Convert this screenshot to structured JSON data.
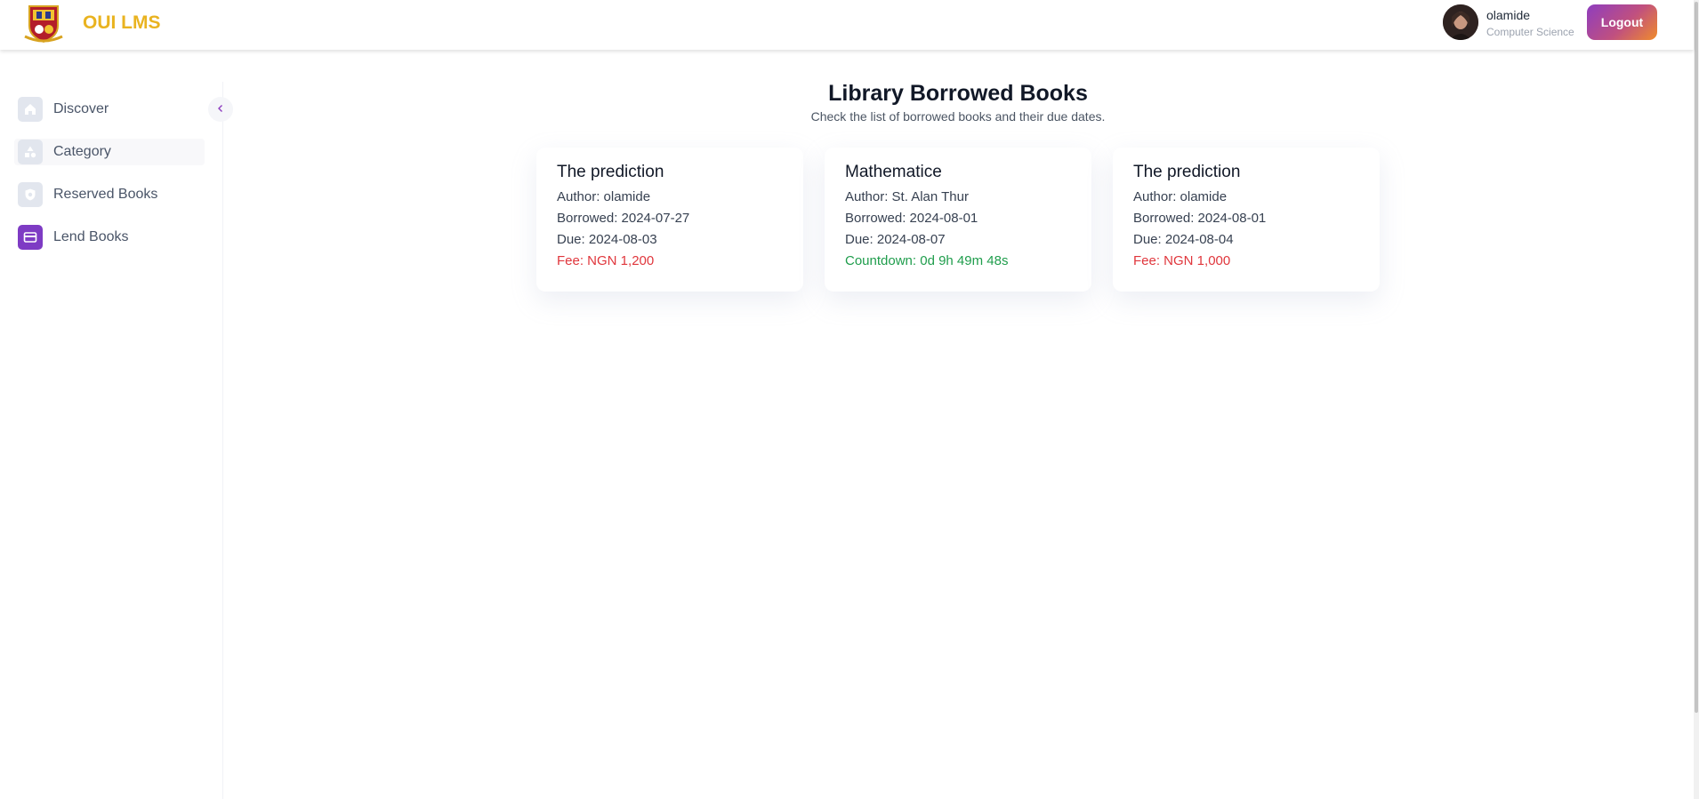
{
  "header": {
    "brand": "OUI LMS",
    "user": {
      "name": "olamide",
      "department": "Computer Science"
    },
    "logout_label": "Logout"
  },
  "sidebar": {
    "items": [
      {
        "label": "Discover",
        "icon": "home-icon"
      },
      {
        "label": "Category",
        "icon": "shapes-icon",
        "active": true
      },
      {
        "label": "Reserved Books",
        "icon": "shield-icon"
      },
      {
        "label": "Lend Books",
        "icon": "card-icon"
      }
    ]
  },
  "main": {
    "title": "Library Borrowed Books",
    "subtitle": "Check the list of borrowed books and their due dates.",
    "cards": [
      {
        "title": "The prediction",
        "author": "Author: olamide",
        "borrowed": "Borrowed: 2024-07-27",
        "due": "Due: 2024-08-03",
        "status": "Fee: NGN 1,200",
        "status_type": "fee"
      },
      {
        "title": "Mathematice",
        "author": "Author: St. Alan Thur",
        "borrowed": "Borrowed: 2024-08-01",
        "due": "Due: 2024-08-07",
        "status": "Countdown: 0d 9h 49m 48s",
        "status_type": "countdown"
      },
      {
        "title": "The prediction",
        "author": "Author: olamide",
        "borrowed": "Borrowed: 2024-08-01",
        "due": "Due: 2024-08-04",
        "status": "Fee: NGN 1,000",
        "status_type": "fee"
      }
    ]
  },
  "colors": {
    "brand": "#e9b320",
    "fee": "#e0363c",
    "countdown": "#1f9d4c",
    "active_icon": "#7e3bc4"
  }
}
